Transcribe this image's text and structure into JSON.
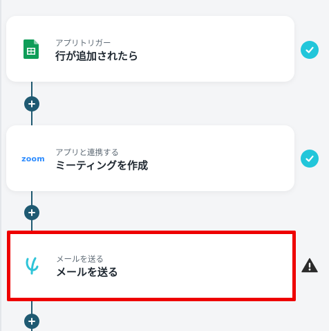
{
  "flow": {
    "steps": [
      {
        "subtitle": "アプリトリガー",
        "title": "行が追加されたら",
        "icon": "google-sheets-icon",
        "status": "complete"
      },
      {
        "subtitle": "アプリと連携する",
        "title": "ミーティングを作成",
        "icon": "zoom-logo",
        "logo_text": "zoom",
        "status": "complete"
      },
      {
        "subtitle": "メールを送る",
        "title": "メールを送る",
        "icon": "mail-yoom-icon",
        "status": "warning",
        "selected": true
      }
    ]
  },
  "colors": {
    "connector": "#1f5a72",
    "check": "#22c6da",
    "selected_border": "#ee0000",
    "sheets_green": "#0f9d58",
    "zoom_blue": "#2d8cff",
    "mail_teal": "#2ec4d8"
  }
}
